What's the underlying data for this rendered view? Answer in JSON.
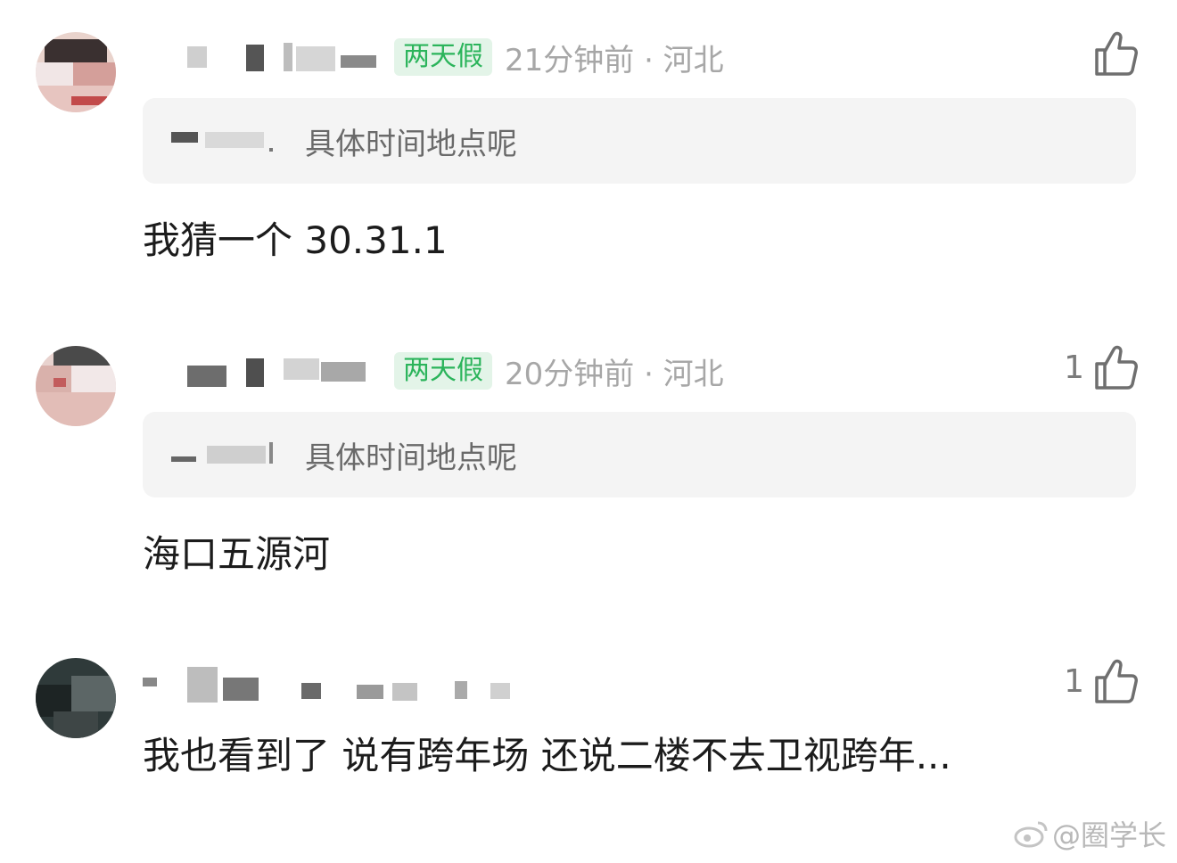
{
  "comments": [
    {
      "badge": "两天假",
      "meta": "21分钟前 · 河北",
      "likes": "",
      "quote_text": "具体时间地点呢",
      "text": "我猜一个 30.31.1"
    },
    {
      "badge": "两天假",
      "meta": "20分钟前 · 河北",
      "likes": "1",
      "quote_text": "具体时间地点呢",
      "text": "海口五源河"
    },
    {
      "likes": "1",
      "text": "我也看到了 说有跨年场 还说二楼不去卫视跨年..."
    }
  ],
  "watermark": {
    "text": "@圈学长"
  },
  "colors": {
    "badge_bg": "#e3f4e8",
    "badge_text": "#2bb45b",
    "meta": "#a7a7a7",
    "quote_bg": "#f4f4f4"
  },
  "icons": [
    "thumb-up-icon",
    "weibo-logo-icon"
  ]
}
